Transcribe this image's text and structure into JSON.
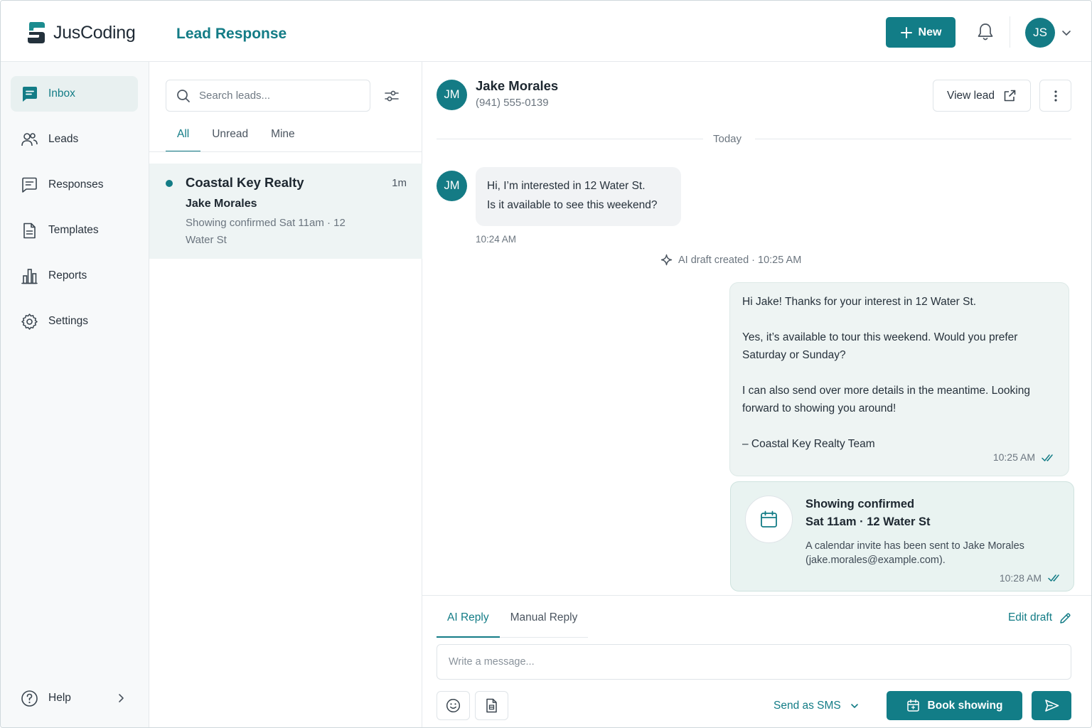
{
  "app": {
    "name": "JusCoding",
    "page_title": "Lead Response"
  },
  "header": {
    "new_button_label": "New",
    "user_initials": "JS"
  },
  "sidebar": {
    "items": [
      {
        "label": "Inbox",
        "icon": "inbox-icon",
        "active": true
      },
      {
        "label": "Leads",
        "icon": "users-icon"
      },
      {
        "label": "Responses",
        "icon": "message-icon"
      },
      {
        "label": "Templates",
        "icon": "document-icon"
      },
      {
        "label": "Reports",
        "icon": "bar-chart-icon"
      },
      {
        "label": "Settings",
        "icon": "gear-icon"
      }
    ],
    "help_label": "Help"
  },
  "lead_list": {
    "search_placeholder": "Search leads...",
    "tabs": [
      "All",
      "Unread",
      "Mine"
    ],
    "active_tab": "All",
    "leads": [
      {
        "company": "Coastal Key Realty",
        "time": "1m",
        "name": "Jake Morales",
        "preview": "Showing confirmed Sat 11am · 12 Water St",
        "unread": true
      }
    ]
  },
  "conversation": {
    "contact": {
      "initials": "JM",
      "name": "Jake Morales",
      "phone": "(941) 555-0139"
    },
    "view_lead_label": "View lead",
    "day_label": "Today",
    "incoming": {
      "lines": [
        "Hi, I’m interested in 12 Water St.",
        "Is it available to see this weekend?"
      ],
      "time": "10:24 AM"
    },
    "ai_note": "AI draft created · 10:25 AM",
    "outgoing": {
      "paragraphs": [
        "Hi Jake! Thanks for your interest in 12 Water St.",
        "Yes, it’s available to tour this weekend. Would you prefer Saturday or Sunday?",
        "I can also send over more details in the meantime. Looking forward to showing you around!",
        "– Coastal Key Realty Team"
      ],
      "time": "10:25 AM"
    },
    "confirmation": {
      "title": "Showing confirmed",
      "subtitle": "Sat 11am · 12 Water St",
      "description": "A calendar invite has been sent to Jake Morales (jake.morales@example.com).",
      "time": "10:28 AM"
    }
  },
  "composer": {
    "tabs": [
      "AI Reply",
      "Manual Reply"
    ],
    "active_tab": "AI Reply",
    "edit_draft_label": "Edit draft",
    "placeholder": "Write a message...",
    "send_as_label": "Send as SMS",
    "book_showing_label": "Book showing"
  },
  "colors": {
    "accent": "#127d87",
    "sidebar_bg": "#f7f9fa",
    "active_bg": "#e8f0f0",
    "bubble_out_bg": "#eef4f3"
  }
}
